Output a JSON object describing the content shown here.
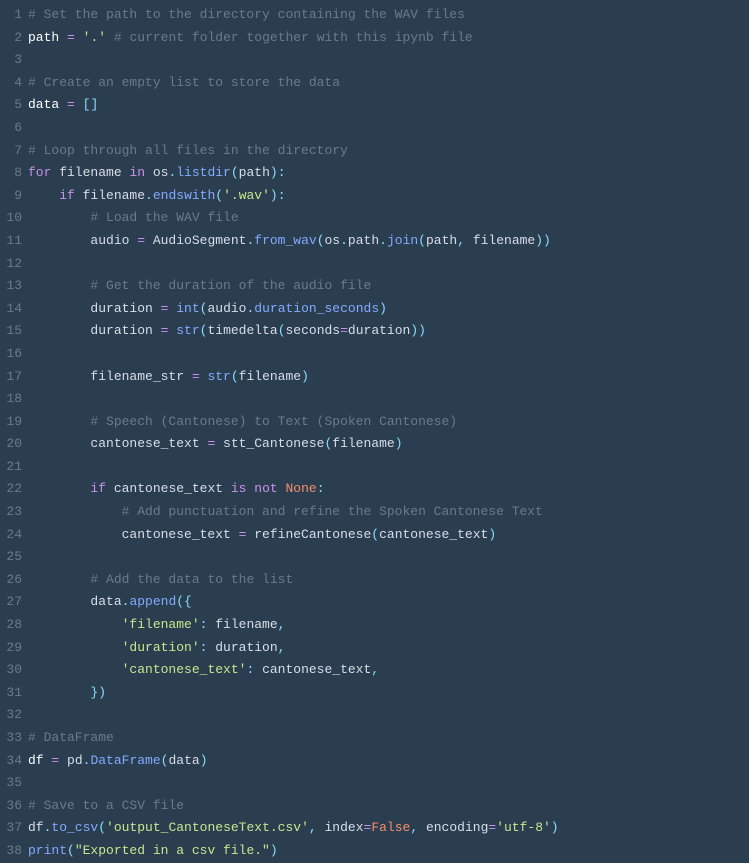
{
  "chart_data": null,
  "code": {
    "lines": [
      {
        "n": "1",
        "tokens": [
          {
            "t": "# Set the path to the directory containing the WAV files",
            "c": "c-comment"
          }
        ]
      },
      {
        "n": "2",
        "tokens": [
          {
            "t": "path",
            "c": "c-white"
          },
          {
            "t": " ",
            "c": "c-ident"
          },
          {
            "t": "=",
            "c": "c-eq"
          },
          {
            "t": " ",
            "c": "c-ident"
          },
          {
            "t": "'.'",
            "c": "c-str"
          },
          {
            "t": " ",
            "c": "c-ident"
          },
          {
            "t": "# current folder together with this ipynb file",
            "c": "c-comment"
          }
        ]
      },
      {
        "n": "3",
        "tokens": []
      },
      {
        "n": "4",
        "tokens": [
          {
            "t": "# Create an empty list to store the data",
            "c": "c-comment"
          }
        ]
      },
      {
        "n": "5",
        "tokens": [
          {
            "t": "data",
            "c": "c-white"
          },
          {
            "t": " ",
            "c": "c-ident"
          },
          {
            "t": "=",
            "c": "c-eq"
          },
          {
            "t": " ",
            "c": "c-ident"
          },
          {
            "t": "[]",
            "c": "c-punc"
          }
        ]
      },
      {
        "n": "6",
        "tokens": []
      },
      {
        "n": "7",
        "tokens": [
          {
            "t": "# Loop through all files in the directory",
            "c": "c-comment"
          }
        ]
      },
      {
        "n": "8",
        "tokens": [
          {
            "t": "for",
            "c": "c-kw"
          },
          {
            "t": " filename ",
            "c": "c-ident"
          },
          {
            "t": "in",
            "c": "c-kw"
          },
          {
            "t": " os",
            "c": "c-ident"
          },
          {
            "t": ".",
            "c": "c-punc"
          },
          {
            "t": "listdir",
            "c": "c-fn"
          },
          {
            "t": "(",
            "c": "c-punc"
          },
          {
            "t": "path",
            "c": "c-ident"
          },
          {
            "t": "):",
            "c": "c-punc"
          }
        ]
      },
      {
        "n": "9",
        "tokens": [
          {
            "t": "    ",
            "c": "c-ident"
          },
          {
            "t": "if",
            "c": "c-kw"
          },
          {
            "t": " filename",
            "c": "c-ident"
          },
          {
            "t": ".",
            "c": "c-punc"
          },
          {
            "t": "endswith",
            "c": "c-fn"
          },
          {
            "t": "(",
            "c": "c-punc"
          },
          {
            "t": "'.wav'",
            "c": "c-str"
          },
          {
            "t": "):",
            "c": "c-punc"
          }
        ]
      },
      {
        "n": "10",
        "tokens": [
          {
            "t": "        ",
            "c": "c-ident"
          },
          {
            "t": "# Load the WAV file",
            "c": "c-comment"
          }
        ]
      },
      {
        "n": "11",
        "tokens": [
          {
            "t": "        audio ",
            "c": "c-ident"
          },
          {
            "t": "=",
            "c": "c-eq"
          },
          {
            "t": " AudioSegment",
            "c": "c-ident"
          },
          {
            "t": ".",
            "c": "c-punc"
          },
          {
            "t": "from_wav",
            "c": "c-fn"
          },
          {
            "t": "(",
            "c": "c-punc"
          },
          {
            "t": "os",
            "c": "c-ident"
          },
          {
            "t": ".",
            "c": "c-punc"
          },
          {
            "t": "path",
            "c": "c-ident"
          },
          {
            "t": ".",
            "c": "c-punc"
          },
          {
            "t": "join",
            "c": "c-fn"
          },
          {
            "t": "(",
            "c": "c-punc"
          },
          {
            "t": "path",
            "c": "c-ident"
          },
          {
            "t": ",",
            "c": "c-punc"
          },
          {
            "t": " filename",
            "c": "c-ident"
          },
          {
            "t": "))",
            "c": "c-punc"
          }
        ]
      },
      {
        "n": "12",
        "tokens": []
      },
      {
        "n": "13",
        "tokens": [
          {
            "t": "        ",
            "c": "c-ident"
          },
          {
            "t": "# Get the duration of the audio file",
            "c": "c-comment"
          }
        ]
      },
      {
        "n": "14",
        "tokens": [
          {
            "t": "        duration ",
            "c": "c-ident"
          },
          {
            "t": "=",
            "c": "c-eq"
          },
          {
            "t": " ",
            "c": "c-ident"
          },
          {
            "t": "int",
            "c": "c-fn"
          },
          {
            "t": "(",
            "c": "c-punc"
          },
          {
            "t": "audio",
            "c": "c-ident"
          },
          {
            "t": ".",
            "c": "c-punc"
          },
          {
            "t": "duration_seconds",
            "c": "c-fn"
          },
          {
            "t": ")",
            "c": "c-punc"
          }
        ]
      },
      {
        "n": "15",
        "tokens": [
          {
            "t": "        duration ",
            "c": "c-ident"
          },
          {
            "t": "=",
            "c": "c-eq"
          },
          {
            "t": " ",
            "c": "c-ident"
          },
          {
            "t": "str",
            "c": "c-fn"
          },
          {
            "t": "(",
            "c": "c-punc"
          },
          {
            "t": "timedelta",
            "c": "c-ident"
          },
          {
            "t": "(",
            "c": "c-punc"
          },
          {
            "t": "seconds",
            "c": "c-ident"
          },
          {
            "t": "=",
            "c": "c-eq"
          },
          {
            "t": "duration",
            "c": "c-ident"
          },
          {
            "t": "))",
            "c": "c-punc"
          }
        ]
      },
      {
        "n": "16",
        "tokens": []
      },
      {
        "n": "17",
        "tokens": [
          {
            "t": "        filename_str ",
            "c": "c-ident"
          },
          {
            "t": "=",
            "c": "c-eq"
          },
          {
            "t": " ",
            "c": "c-ident"
          },
          {
            "t": "str",
            "c": "c-fn"
          },
          {
            "t": "(",
            "c": "c-punc"
          },
          {
            "t": "filename",
            "c": "c-ident"
          },
          {
            "t": ")",
            "c": "c-punc"
          }
        ]
      },
      {
        "n": "18",
        "tokens": []
      },
      {
        "n": "19",
        "tokens": [
          {
            "t": "        ",
            "c": "c-ident"
          },
          {
            "t": "# Speech (Cantonese) to Text (Spoken Cantonese)",
            "c": "c-comment"
          }
        ]
      },
      {
        "n": "20",
        "tokens": [
          {
            "t": "        cantonese_text ",
            "c": "c-ident"
          },
          {
            "t": "=",
            "c": "c-eq"
          },
          {
            "t": " stt_Cantonese",
            "c": "c-ident"
          },
          {
            "t": "(",
            "c": "c-punc"
          },
          {
            "t": "filename",
            "c": "c-ident"
          },
          {
            "t": ")",
            "c": "c-punc"
          }
        ]
      },
      {
        "n": "21",
        "tokens": []
      },
      {
        "n": "22",
        "tokens": [
          {
            "t": "        ",
            "c": "c-ident"
          },
          {
            "t": "if",
            "c": "c-kw"
          },
          {
            "t": " cantonese_text ",
            "c": "c-ident"
          },
          {
            "t": "is",
            "c": "c-kw"
          },
          {
            "t": " ",
            "c": "c-ident"
          },
          {
            "t": "not",
            "c": "c-kw"
          },
          {
            "t": " ",
            "c": "c-ident"
          },
          {
            "t": "None",
            "c": "c-bool"
          },
          {
            "t": ":",
            "c": "c-punc"
          }
        ]
      },
      {
        "n": "23",
        "tokens": [
          {
            "t": "            ",
            "c": "c-ident"
          },
          {
            "t": "# Add punctuation and refine the Spoken Cantonese Text",
            "c": "c-comment"
          }
        ]
      },
      {
        "n": "24",
        "tokens": [
          {
            "t": "            cantonese_text ",
            "c": "c-ident"
          },
          {
            "t": "=",
            "c": "c-eq"
          },
          {
            "t": " refineCantonese",
            "c": "c-ident"
          },
          {
            "t": "(",
            "c": "c-punc"
          },
          {
            "t": "cantonese_text",
            "c": "c-ident"
          },
          {
            "t": ")",
            "c": "c-punc"
          }
        ]
      },
      {
        "n": "25",
        "tokens": []
      },
      {
        "n": "26",
        "tokens": [
          {
            "t": "        ",
            "c": "c-ident"
          },
          {
            "t": "# Add the data to the list",
            "c": "c-comment"
          }
        ]
      },
      {
        "n": "27",
        "tokens": [
          {
            "t": "        data",
            "c": "c-ident"
          },
          {
            "t": ".",
            "c": "c-punc"
          },
          {
            "t": "append",
            "c": "c-fn"
          },
          {
            "t": "({",
            "c": "c-punc"
          }
        ]
      },
      {
        "n": "28",
        "tokens": [
          {
            "t": "            ",
            "c": "c-ident"
          },
          {
            "t": "'filename'",
            "c": "c-str"
          },
          {
            "t": ":",
            "c": "c-punc"
          },
          {
            "t": " filename",
            "c": "c-ident"
          },
          {
            "t": ",",
            "c": "c-punc"
          }
        ]
      },
      {
        "n": "29",
        "tokens": [
          {
            "t": "            ",
            "c": "c-ident"
          },
          {
            "t": "'duration'",
            "c": "c-str"
          },
          {
            "t": ":",
            "c": "c-punc"
          },
          {
            "t": " duration",
            "c": "c-ident"
          },
          {
            "t": ",",
            "c": "c-punc"
          }
        ]
      },
      {
        "n": "30",
        "tokens": [
          {
            "t": "            ",
            "c": "c-ident"
          },
          {
            "t": "'cantonese_text'",
            "c": "c-str"
          },
          {
            "t": ":",
            "c": "c-punc"
          },
          {
            "t": " cantonese_text",
            "c": "c-ident"
          },
          {
            "t": ",",
            "c": "c-punc"
          }
        ]
      },
      {
        "n": "31",
        "tokens": [
          {
            "t": "        ",
            "c": "c-ident"
          },
          {
            "t": "})",
            "c": "c-punc"
          }
        ]
      },
      {
        "n": "32",
        "tokens": []
      },
      {
        "n": "33",
        "tokens": [
          {
            "t": "# DataFrame",
            "c": "c-comment"
          }
        ]
      },
      {
        "n": "34",
        "tokens": [
          {
            "t": "df",
            "c": "c-white"
          },
          {
            "t": " ",
            "c": "c-ident"
          },
          {
            "t": "=",
            "c": "c-eq"
          },
          {
            "t": " pd",
            "c": "c-ident"
          },
          {
            "t": ".",
            "c": "c-punc"
          },
          {
            "t": "DataFrame",
            "c": "c-fn"
          },
          {
            "t": "(",
            "c": "c-punc"
          },
          {
            "t": "data",
            "c": "c-ident"
          },
          {
            "t": ")",
            "c": "c-punc"
          }
        ]
      },
      {
        "n": "35",
        "tokens": []
      },
      {
        "n": "36",
        "tokens": [
          {
            "t": "# Save to a CSV file",
            "c": "c-comment"
          }
        ]
      },
      {
        "n": "37",
        "tokens": [
          {
            "t": "df",
            "c": "c-ident"
          },
          {
            "t": ".",
            "c": "c-punc"
          },
          {
            "t": "to_csv",
            "c": "c-fn"
          },
          {
            "t": "(",
            "c": "c-punc"
          },
          {
            "t": "'output_CantoneseText.csv'",
            "c": "c-str"
          },
          {
            "t": ",",
            "c": "c-punc"
          },
          {
            "t": " index",
            "c": "c-ident"
          },
          {
            "t": "=",
            "c": "c-eq"
          },
          {
            "t": "False",
            "c": "c-bool"
          },
          {
            "t": ",",
            "c": "c-punc"
          },
          {
            "t": " encoding",
            "c": "c-ident"
          },
          {
            "t": "=",
            "c": "c-eq"
          },
          {
            "t": "'utf-8'",
            "c": "c-str"
          },
          {
            "t": ")",
            "c": "c-punc"
          }
        ]
      },
      {
        "n": "38",
        "tokens": [
          {
            "t": "print",
            "c": "c-fn"
          },
          {
            "t": "(",
            "c": "c-punc"
          },
          {
            "t": "\"Exported in a csv file.\"",
            "c": "c-str"
          },
          {
            "t": ")",
            "c": "c-punc"
          }
        ]
      }
    ]
  }
}
